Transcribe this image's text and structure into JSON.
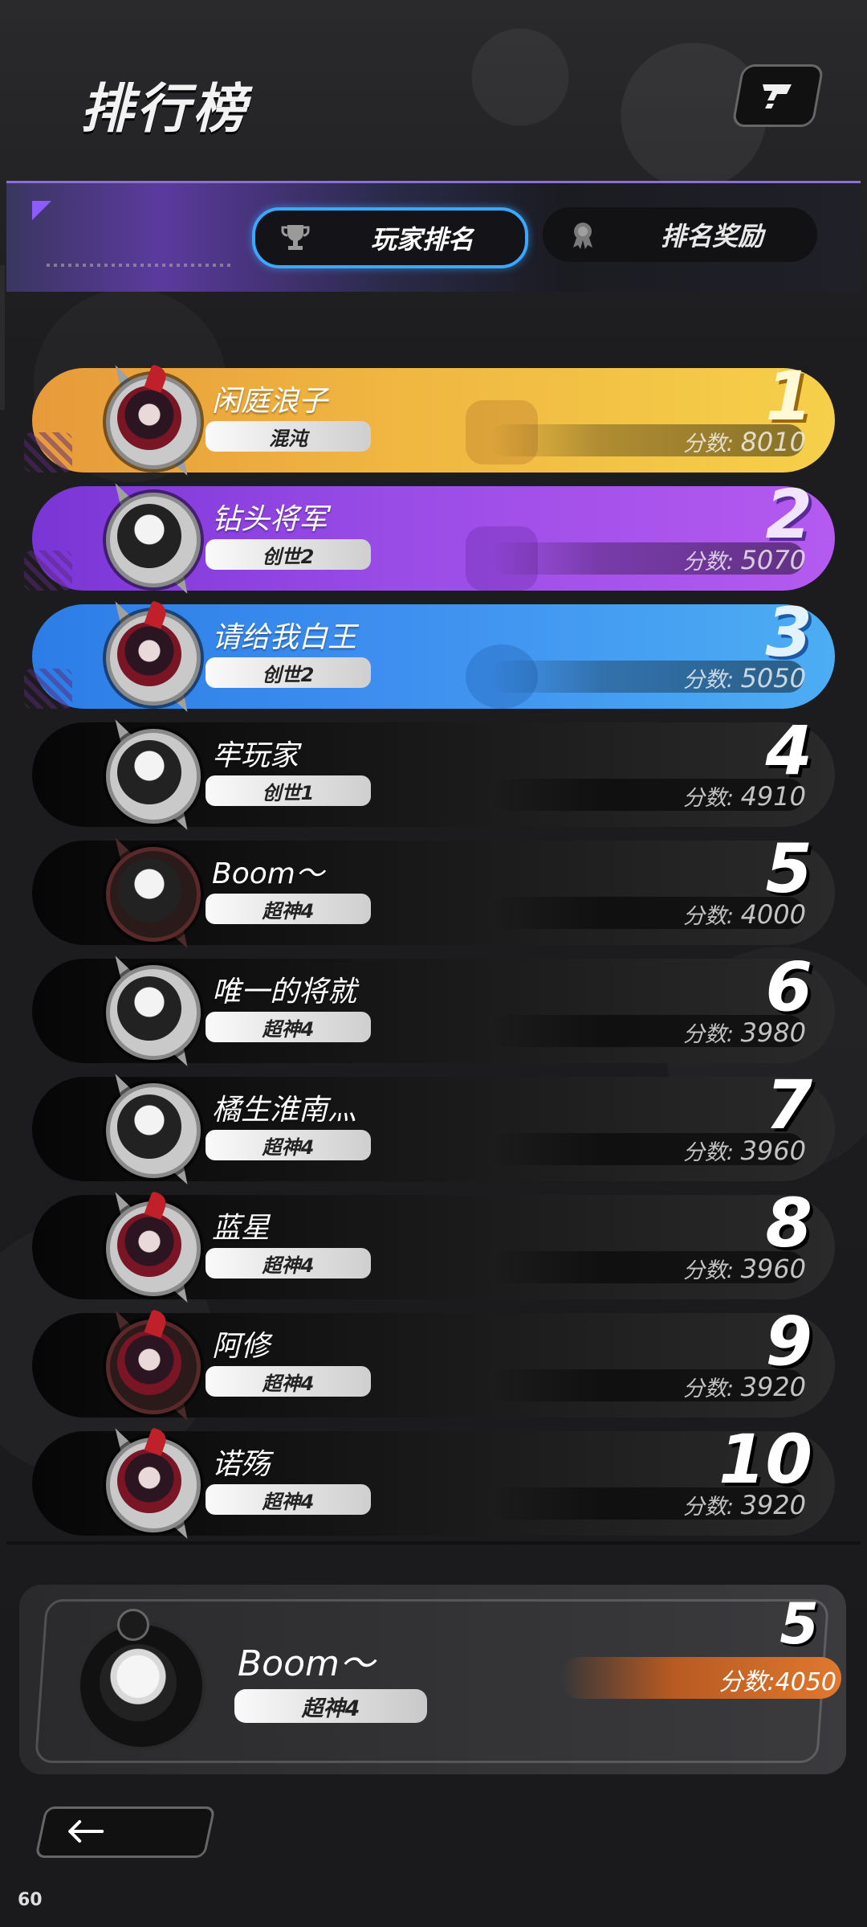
{
  "header": {
    "title": "排行榜",
    "help_icon": "help-icon"
  },
  "tabs": [
    {
      "label": "玩家排名",
      "icon": "trophy-icon",
      "active": true
    },
    {
      "label": "排名奖励",
      "icon": "medal-icon",
      "active": false
    }
  ],
  "score_label": "分数: ",
  "leaderboard": [
    {
      "rank": "1",
      "name": "闲庭浪子",
      "tier": "混沌",
      "score": "8010",
      "style": "gold"
    },
    {
      "rank": "2",
      "name": "钻头将军",
      "tier": "创世2",
      "score": "5070",
      "style": "purple"
    },
    {
      "rank": "3",
      "name": "请给我白王",
      "tier": "创世2",
      "score": "5050",
      "style": "blue"
    },
    {
      "rank": "4",
      "name": "牢玩家",
      "tier": "创世1",
      "score": "4910",
      "style": "dark"
    },
    {
      "rank": "5",
      "name": "Boom〜",
      "tier": "超神4",
      "score": "4000",
      "style": "dark"
    },
    {
      "rank": "6",
      "name": "唯一的将就",
      "tier": "超神4",
      "score": "3980",
      "style": "dark"
    },
    {
      "rank": "7",
      "name": "橘生淮南灬",
      "tier": "超神4",
      "score": "3960",
      "style": "dark"
    },
    {
      "rank": "8",
      "name": "蓝星",
      "tier": "超神4",
      "score": "3960",
      "style": "dark"
    },
    {
      "rank": "9",
      "name": "阿修",
      "tier": "超神4",
      "score": "3920",
      "style": "dark"
    },
    {
      "rank": "10",
      "name": "诺殇",
      "tier": "超神4",
      "score": "3920",
      "style": "dark"
    }
  ],
  "my_rank": {
    "rank": "5",
    "name": "Boom〜",
    "tier": "超神4",
    "score_text": "分数:4050"
  },
  "footer": {
    "back_icon": "arrow-left-icon",
    "fps": "60"
  },
  "colors": {
    "gold": "#efb440",
    "purple": "#9a4ce6",
    "blue": "#3e8ff0",
    "accent_blue": "#3aa8ff",
    "my_score_orange": "#e0782e"
  }
}
